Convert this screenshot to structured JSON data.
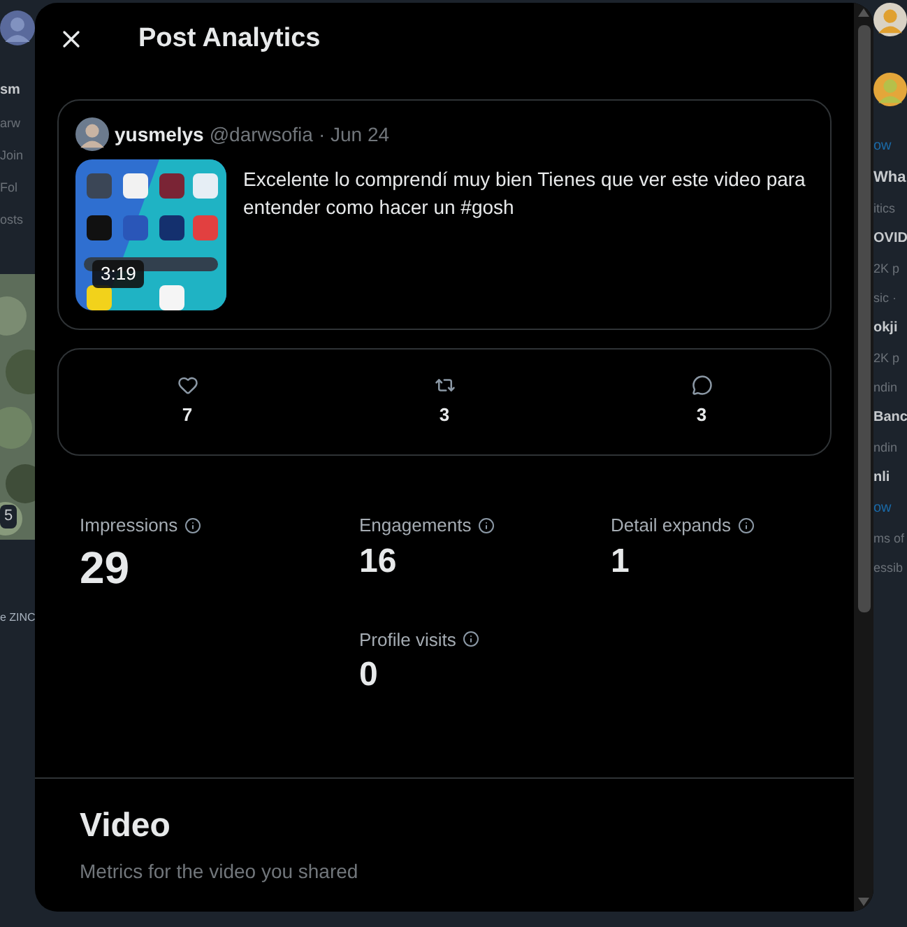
{
  "background": {
    "left_fragments": [
      {
        "text": "sm",
        "kind": "bold"
      },
      {
        "text": "arw",
        "kind": "muted"
      },
      {
        "text": "Join",
        "kind": "muted"
      },
      {
        "text": "Fol",
        "kind": "muted"
      },
      {
        "text": "osts",
        "kind": "muted"
      }
    ],
    "left_badge": "5",
    "left_caption": "e ZINC",
    "right_fragments": [
      {
        "text": "ow",
        "kind": "link"
      },
      {
        "text": "Wha",
        "kind": "heading"
      },
      {
        "text": "itics",
        "kind": "muted"
      },
      {
        "text": "OVID",
        "kind": "bold"
      },
      {
        "text": "2K p",
        "kind": "muted"
      },
      {
        "text": "sic ·",
        "kind": "muted"
      },
      {
        "text": "okji",
        "kind": "bold"
      },
      {
        "text": "2K p",
        "kind": "muted"
      },
      {
        "text": "ndin",
        "kind": "muted"
      },
      {
        "text": "Banc",
        "kind": "bold"
      },
      {
        "text": "ndin",
        "kind": "muted"
      },
      {
        "text": "nli",
        "kind": "bold"
      },
      {
        "text": "ow",
        "kind": "link"
      },
      {
        "text": "ms of",
        "kind": "muted"
      },
      {
        "text": "essib",
        "kind": "muted"
      }
    ]
  },
  "modal": {
    "title": "Post Analytics",
    "post": {
      "name": "yusmelys",
      "handle": "@darwsofia",
      "date": "· Jun 24",
      "duration": "3:19",
      "text": "Excelente lo comprendí muy bien Tienes que ver este video para entender como hacer un #gosh"
    },
    "engagement": [
      {
        "kind": "like",
        "count": "7"
      },
      {
        "kind": "repost",
        "count": "3"
      },
      {
        "kind": "reply",
        "count": "3"
      }
    ],
    "metrics": [
      {
        "label": "Impressions",
        "value": "29",
        "emphasized": true
      },
      {
        "label": "Engagements",
        "value": "16",
        "emphasized": false
      },
      {
        "label": "Detail expands",
        "value": "1",
        "emphasized": false
      },
      {
        "label": "Profile visits",
        "value": "0",
        "emphasized": false
      }
    ],
    "section": {
      "title": "Video",
      "subtitle": "Metrics for the video you shared"
    }
  }
}
